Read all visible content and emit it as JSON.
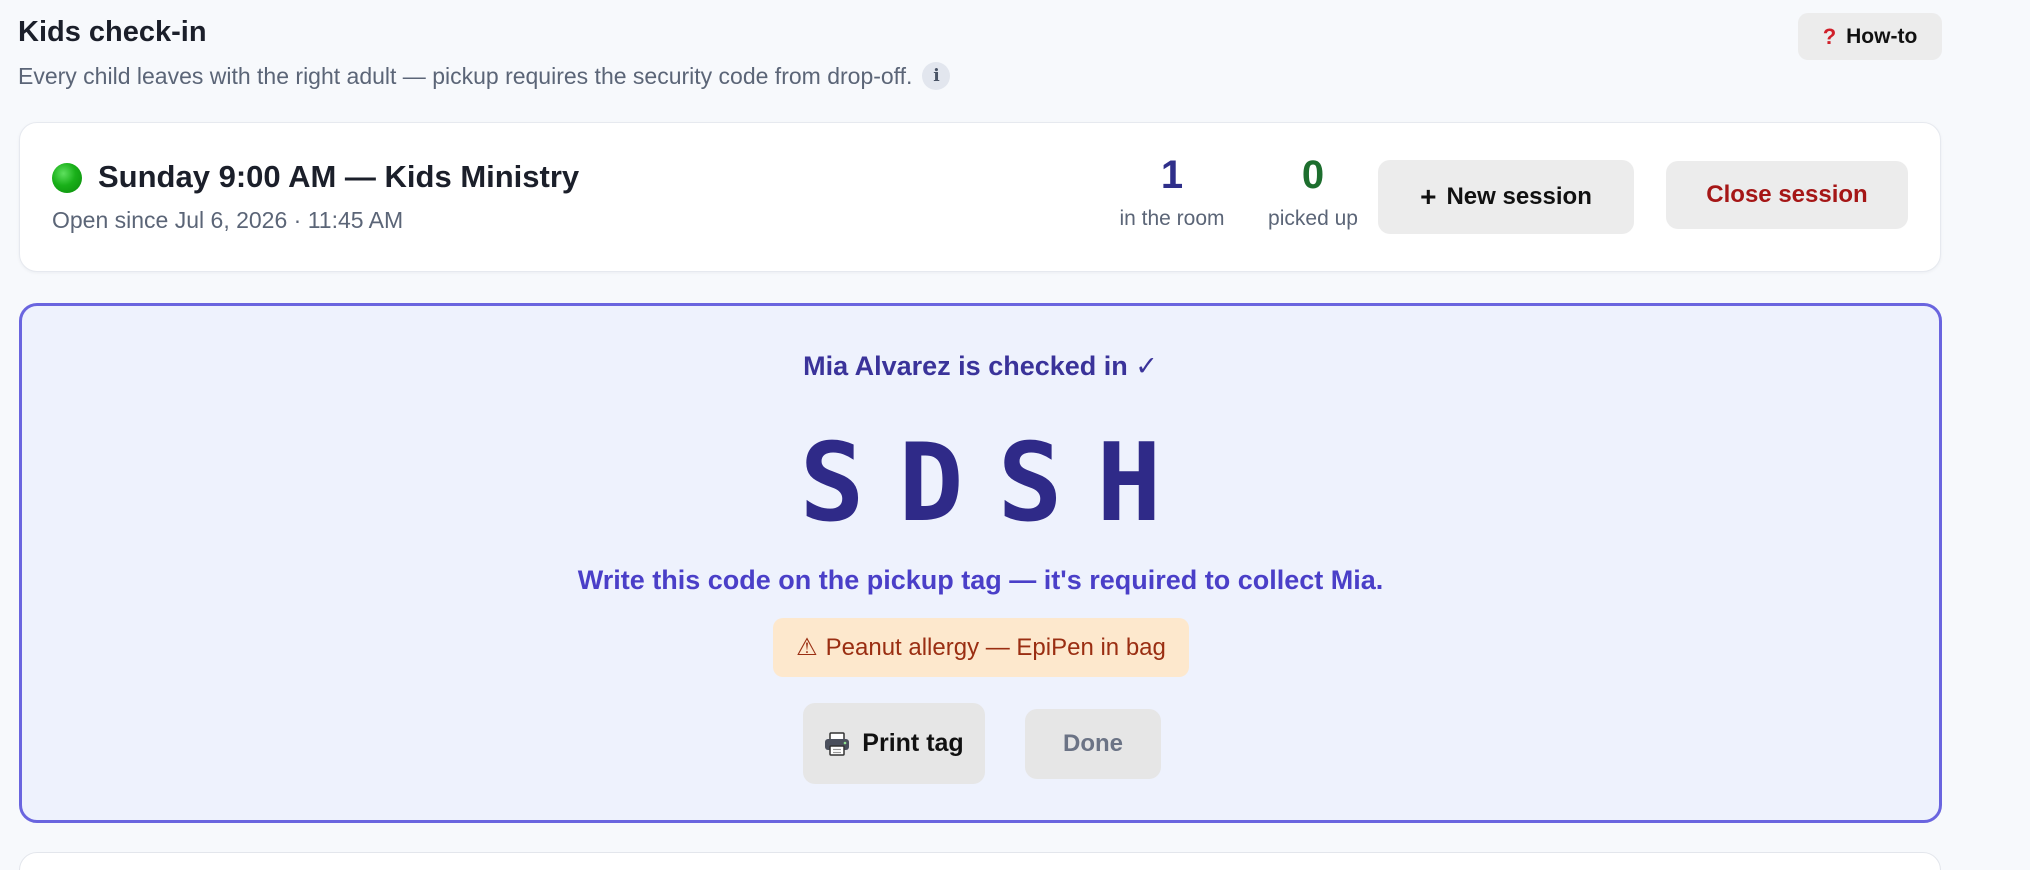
{
  "header": {
    "title": "Kids check-in",
    "subtitle": "Every child leaves with the right adult — pickup requires the security code from drop-off.",
    "info_icon": "i",
    "howto_icon": "?",
    "howto_label": "How-to"
  },
  "session": {
    "status_color": "#19b019",
    "name": "Sunday 9:00 AM — Kids Ministry",
    "open_since": "Open since Jul 6, 2026 · 11:45 AM",
    "stats": {
      "in_room_value": "1",
      "in_room_label": "in the room",
      "picked_up_value": "0",
      "picked_up_label": "picked up"
    },
    "new_session_icon": "+",
    "new_session_label": "New session",
    "close_session_label": "Close session"
  },
  "checkin": {
    "message": "Mia Alvarez is checked in ✓",
    "security_code": "SDSH",
    "instructions": "Write this code on the pickup tag — it's required to collect Mia.",
    "allergy_icon": "⚠",
    "allergy_text": "Peanut allergy — EpiPen in bag",
    "print_label": "Print tag",
    "done_label": "Done"
  },
  "colors": {
    "accent": "#6a65df",
    "panel_bg": "#eef2fd",
    "code": "#2f2a88",
    "danger": "#a51616",
    "picked_up": "#1d6e2e",
    "allergy_bg": "#fde8cd"
  }
}
